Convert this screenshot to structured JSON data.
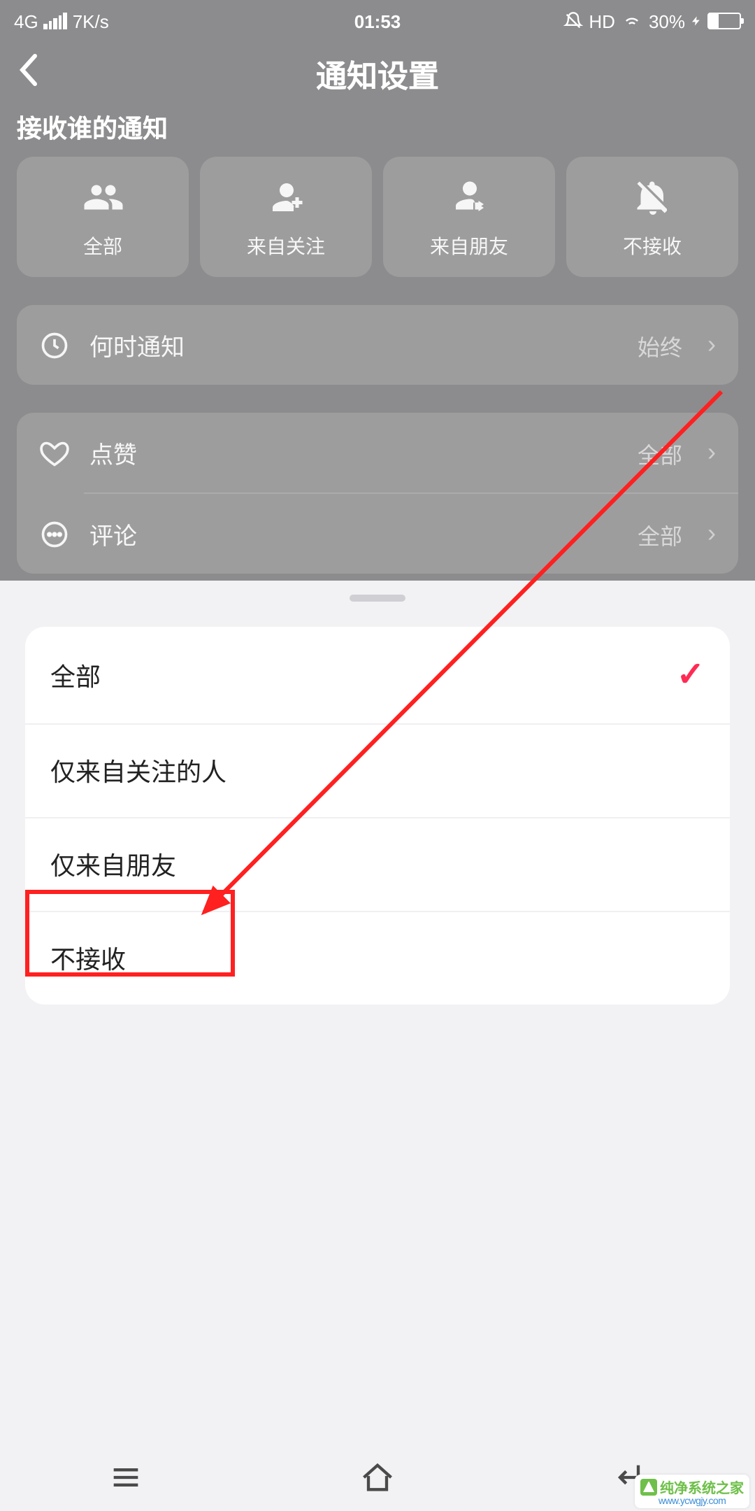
{
  "status": {
    "network": "4G",
    "speed": "7K/s",
    "time": "01:53",
    "hd": "HD",
    "battery": "30%"
  },
  "header": {
    "title": "通知设置"
  },
  "section_title": "接收谁的通知",
  "options": {
    "all": "全部",
    "following": "来自关注",
    "friends": "来自朋友",
    "none": "不接收"
  },
  "rows": {
    "when": {
      "label": "何时通知",
      "value": "始终"
    },
    "like": {
      "label": "点赞",
      "value": "全部"
    },
    "comment": {
      "label": "评论",
      "value": "全部"
    }
  },
  "sheet": {
    "opt1": "全部",
    "opt2": "仅来自关注的人",
    "opt3": "仅来自朋友",
    "opt4": "不接收"
  },
  "watermark": {
    "brand": "纯净系统之家",
    "url": "www.ycwgjy.com"
  }
}
